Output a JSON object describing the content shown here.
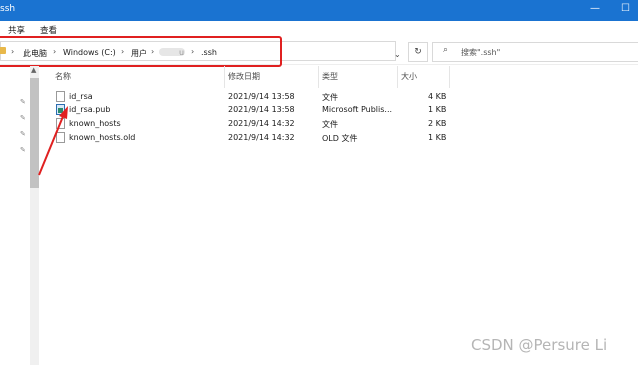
{
  "window": {
    "title": "ssh",
    "minimize": "—",
    "maximize": "☐"
  },
  "ribbon": {
    "tabs": [
      "共享",
      "查看"
    ]
  },
  "address": {
    "crumbs": [
      "此电脑",
      "Windows (C:)",
      "用户",
      "u",
      ".ssh"
    ],
    "separator": "›",
    "dropdown": "⌄",
    "refresh": "↻"
  },
  "search": {
    "icon": "⌕",
    "placeholder": "搜索\".ssh\""
  },
  "columns": {
    "name": "名称",
    "modified": "修改日期",
    "type": "类型",
    "size": "大小"
  },
  "files": [
    {
      "name": "id_rsa",
      "modified": "2021/9/14 13:58",
      "type": "文件",
      "size": "4 KB",
      "icon": "blank-file-icon"
    },
    {
      "name": "id_rsa.pub",
      "modified": "2021/9/14 13:58",
      "type": "Microsoft Publis...",
      "size": "1 KB",
      "icon": "publisher-file-icon"
    },
    {
      "name": "known_hosts",
      "modified": "2021/9/14 14:32",
      "type": "文件",
      "size": "2 KB",
      "icon": "blank-file-icon"
    },
    {
      "name": "known_hosts.old",
      "modified": "2021/9/14 14:32",
      "type": "OLD 文件",
      "size": "1 KB",
      "icon": "blank-file-icon"
    }
  ],
  "watermark": "CSDN @Persure Li",
  "colors": {
    "titlebar": "#1a73d1",
    "annotation": "#e02020"
  }
}
